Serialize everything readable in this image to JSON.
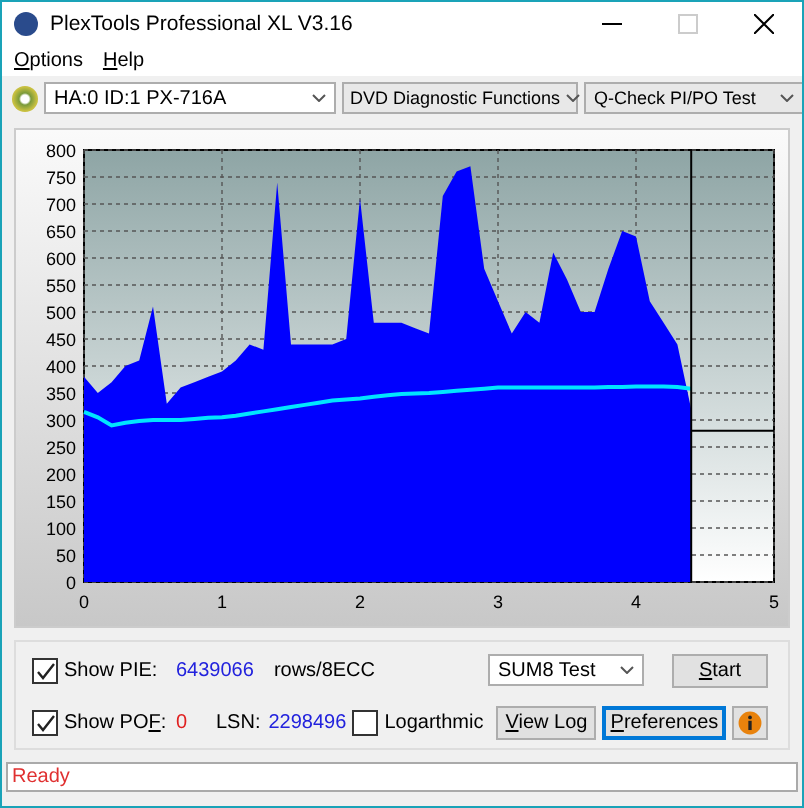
{
  "window": {
    "title": "PlexTools Professional XL V3.16"
  },
  "menu": [
    {
      "mnemonic": "O",
      "rest": "ptions"
    },
    {
      "mnemonic": "H",
      "rest": "elp"
    }
  ],
  "toolbar": {
    "drive": "HA:0 ID:1  PX-716A",
    "function": "DVD Diagnostic Functions",
    "test": "Q-Check PI/PO Test"
  },
  "chart": {
    "chart_data": {
      "type": "area",
      "x": [
        0,
        0.1,
        0.2,
        0.3,
        0.4,
        0.5,
        0.6,
        0.7,
        0.8,
        0.9,
        1.0,
        1.1,
        1.2,
        1.3,
        1.4,
        1.5,
        1.6,
        1.7,
        1.8,
        1.9,
        2.0,
        2.1,
        2.2,
        2.3,
        2.4,
        2.5,
        2.6,
        2.7,
        2.8,
        2.9,
        3.0,
        3.1,
        3.2,
        3.3,
        3.4,
        3.5,
        3.6,
        3.7,
        3.8,
        3.9,
        4.0,
        4.1,
        4.2,
        4.3,
        4.4
      ],
      "series": [
        {
          "color": "#0000ff",
          "values": [
            380,
            350,
            370,
            400,
            410,
            510,
            330,
            360,
            370,
            380,
            390,
            410,
            440,
            430,
            740,
            440,
            440,
            440,
            440,
            450,
            710,
            480,
            480,
            480,
            470,
            460,
            715,
            760,
            770,
            580,
            520,
            460,
            500,
            480,
            610,
            560,
            500,
            500,
            580,
            650,
            640,
            520,
            480,
            440,
            320
          ]
        },
        {
          "color": "#00e5ff",
          "type": "line",
          "values": [
            315,
            305,
            290,
            295,
            298,
            300,
            300,
            300,
            302,
            304,
            305,
            308,
            312,
            316,
            320,
            324,
            328,
            332,
            336,
            338,
            340,
            343,
            346,
            348,
            349,
            350,
            352,
            354,
            356,
            358,
            360,
            360,
            360,
            360,
            360,
            360,
            360,
            360,
            361,
            361,
            362,
            362,
            362,
            361,
            358
          ]
        }
      ],
      "xlim": [
        0,
        5
      ],
      "ylim": [
        0,
        800
      ],
      "xticks": [
        {
          "value": 0,
          "label": "0"
        },
        {
          "value": 1,
          "label": "1"
        },
        {
          "value": 2,
          "label": "2"
        },
        {
          "value": 3,
          "label": "3"
        },
        {
          "value": 4,
          "label": "4"
        },
        {
          "value": 5,
          "label": "5"
        }
      ],
      "yticks": [
        0,
        50,
        100,
        150,
        200,
        250,
        300,
        350,
        400,
        450,
        500,
        550,
        600,
        650,
        700,
        750,
        800
      ],
      "grid": true,
      "ref_lines": [
        {
          "axis": "x",
          "value": 4.4
        },
        {
          "axis": "y",
          "value": 280
        }
      ]
    }
  },
  "pie": {
    "label": "Show PIE:",
    "checked": true,
    "value": "6439066",
    "unit": "rows/8ECC"
  },
  "pof": {
    "lead": "Show PO",
    "mnemonic": "F",
    "rest": ":",
    "checked": true,
    "value": "0"
  },
  "lsn": {
    "label": "LSN:",
    "value": "2298496"
  },
  "logarithmic": {
    "label": "Logarthmic",
    "checked": false
  },
  "test_mode": "SUM8 Test",
  "buttons": [
    {
      "mnemonic": "S",
      "rest": "tart",
      "focused": false
    },
    {
      "mnemonic": "V",
      "rest": "iew Log",
      "focused": false
    },
    {
      "mnemonic": "P",
      "rest": "references",
      "focused": true
    }
  ],
  "status_bar": {
    "text": "Ready"
  }
}
